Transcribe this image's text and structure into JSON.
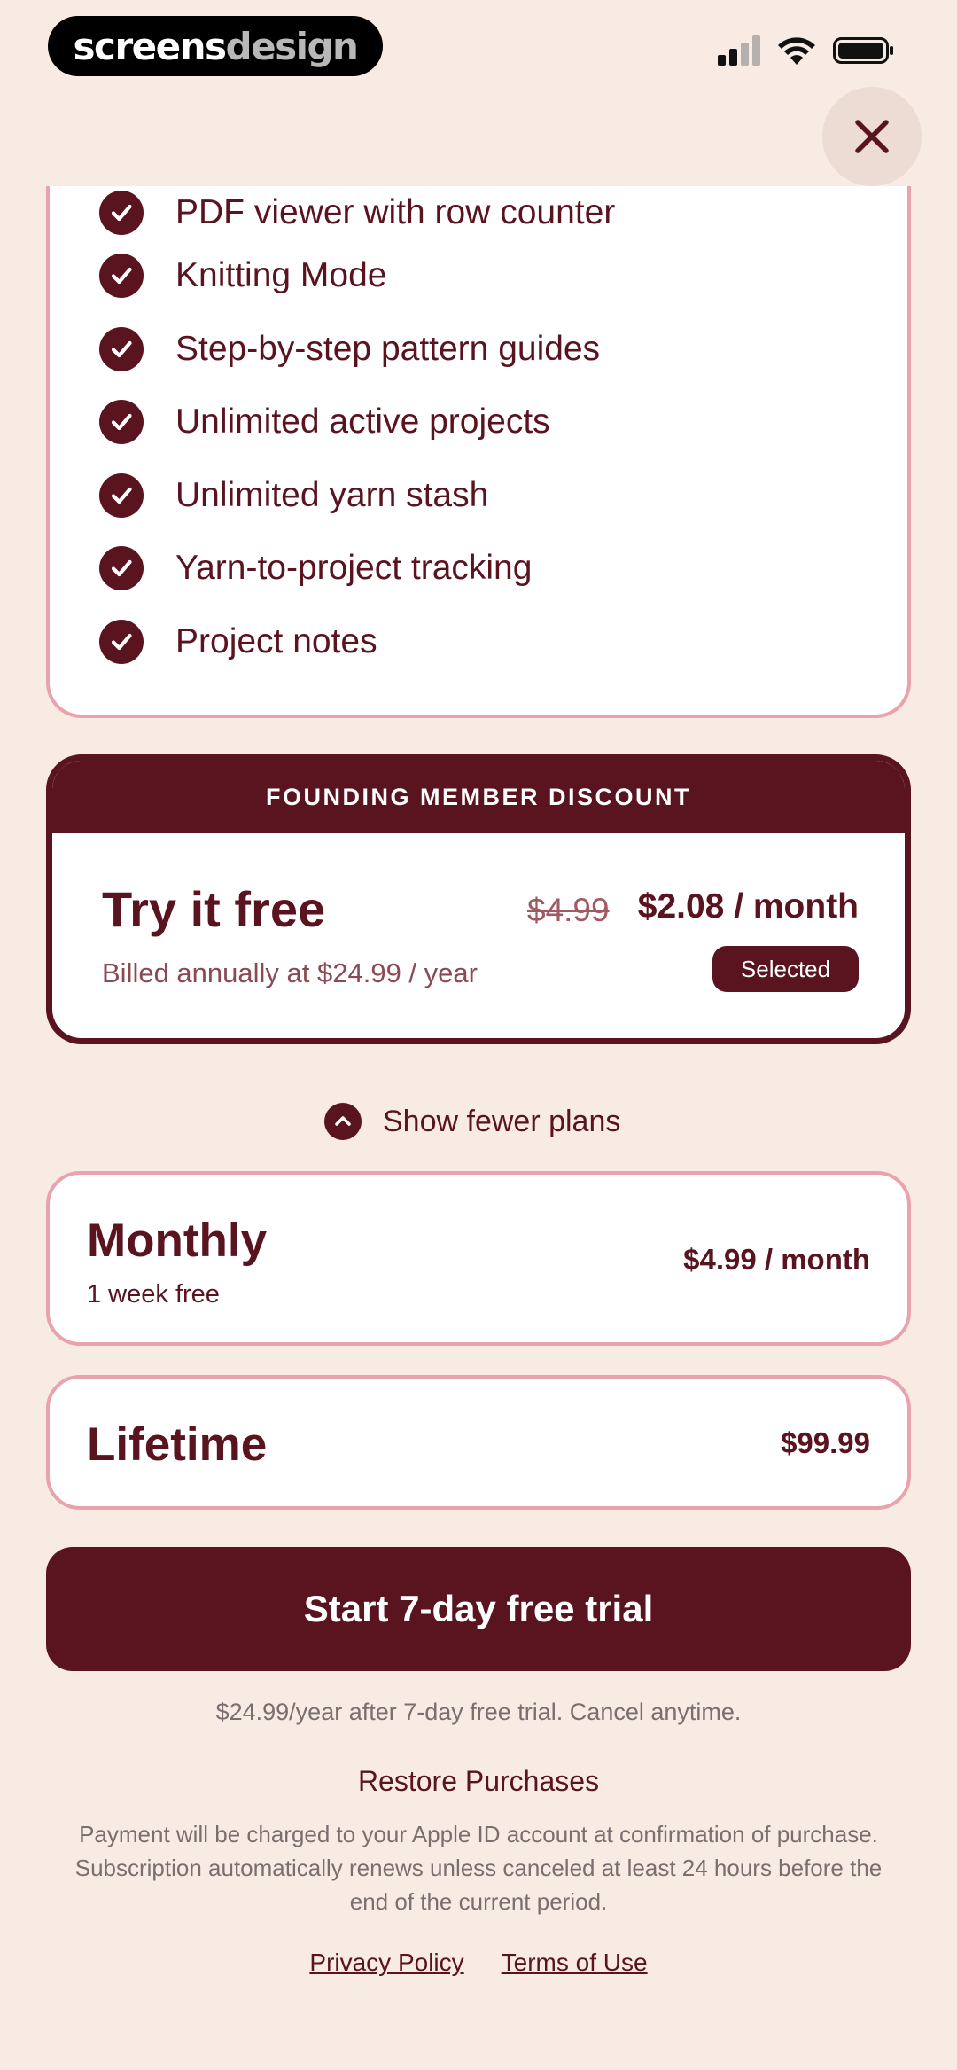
{
  "status_bar": {
    "brand_part1": "screens",
    "brand_part2": "design",
    "icons": [
      "signal-icon",
      "wifi-icon",
      "battery-icon"
    ]
  },
  "close": {
    "icon": "close-icon"
  },
  "features": [
    "PDF viewer with row counter",
    "Knitting Mode",
    "Step-by-step pattern guides",
    "Unlimited active projects",
    "Unlimited yarn stash",
    "Yarn-to-project tracking",
    "Project notes"
  ],
  "founding_plan": {
    "banner": "FOUNDING MEMBER DISCOUNT",
    "title": "Try it free",
    "old_price": "$4.99",
    "price": "$2.08 / month",
    "billed": "Billed annually at $24.99 / year",
    "badge": "Selected"
  },
  "toggle": {
    "label": "Show fewer plans"
  },
  "plans": {
    "monthly": {
      "name": "Monthly",
      "sub": "1 week free",
      "price": "$4.99 / month"
    },
    "lifetime": {
      "name": "Lifetime",
      "price": "$99.99"
    }
  },
  "cta": {
    "label": "Start 7-day free trial"
  },
  "trial_note": "$24.99/year after 7-day free trial. Cancel anytime.",
  "restore": "Restore Purchases",
  "legal": "Payment will be charged to your Apple ID account at confirmation of purchase. Subscription automatically renews unless canceled at least 24 hours before the end of the current period.",
  "footer": {
    "privacy": "Privacy Policy",
    "terms": "Terms of Use"
  },
  "colors": {
    "background": "#f7ebe3",
    "maroon": "#5a1420",
    "pink_border": "#e8a3ad"
  }
}
